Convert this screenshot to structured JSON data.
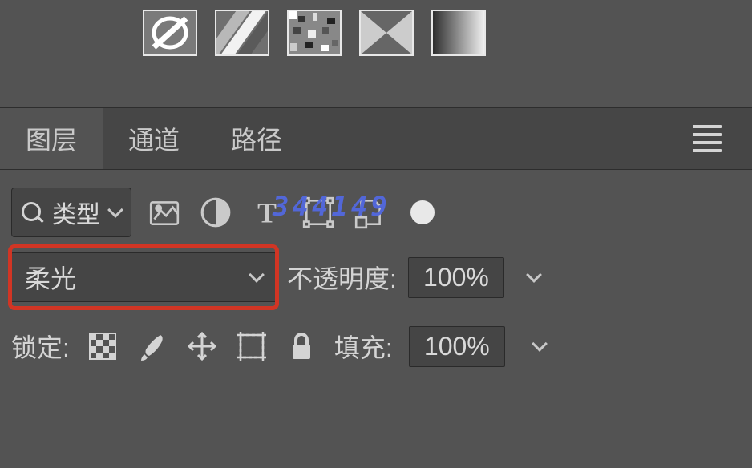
{
  "tabs": {
    "layers": "图层",
    "channels": "通道",
    "paths": "路径"
  },
  "filter": {
    "kind_label": "类型"
  },
  "blend": {
    "mode": "柔光",
    "opacity_label": "不透明度:",
    "opacity_value": "100%"
  },
  "lock": {
    "label": "锁定:",
    "fill_label": "填充:",
    "fill_value": "100%"
  },
  "watermark": "344149"
}
